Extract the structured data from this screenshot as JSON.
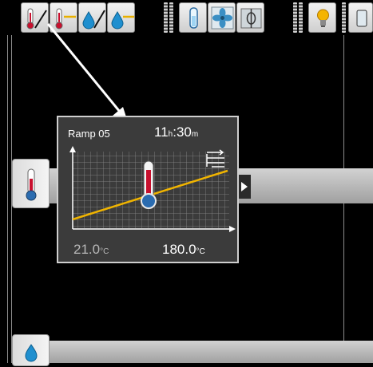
{
  "colors": {
    "background": "#000000",
    "popup_bg": "#3b3b3b",
    "ramp_line": "#f0b400",
    "track": "#b8b8b8"
  },
  "toolbar": {
    "groups": [
      [
        "thermometer-ramp-icon",
        "thermometer-hold-icon",
        "drop-ramp-icon",
        "drop-hold-icon"
      ],
      [
        "ampoule-icon",
        "fan-icon",
        "damper-icon"
      ],
      [
        "lamp-icon",
        "partial-icon"
      ]
    ]
  },
  "ramp_popup": {
    "program": "Ramp 05",
    "duration_hours": "11",
    "duration_hours_unit": "h",
    "duration_sep": ":",
    "duration_minutes": "30",
    "duration_minutes_unit": "m",
    "start_temp": "21.0",
    "start_unit": "°C",
    "end_temp": "180.0",
    "end_unit": "°C"
  }
}
